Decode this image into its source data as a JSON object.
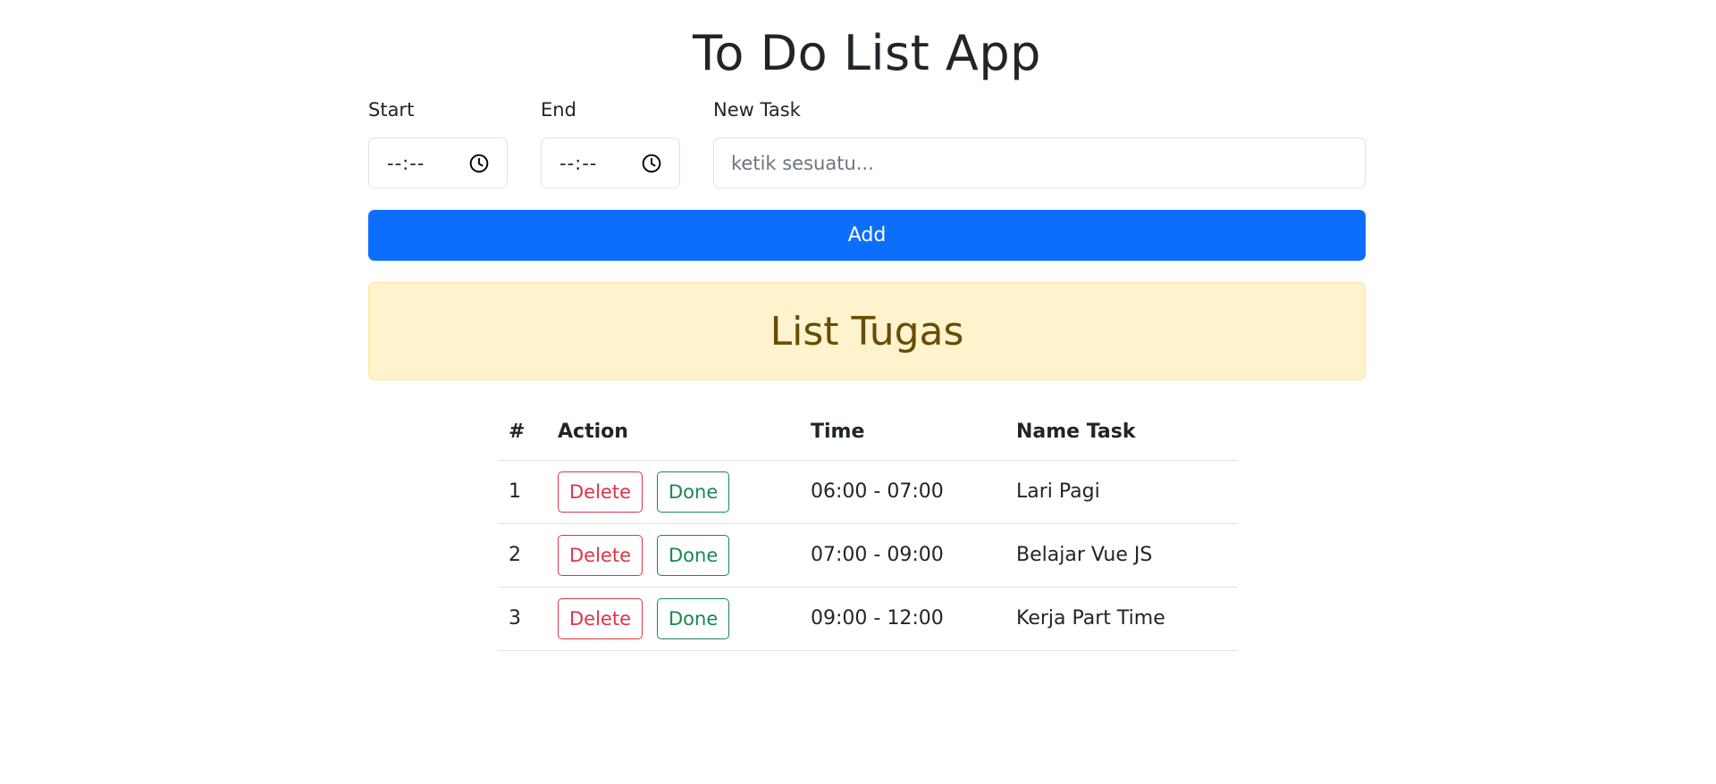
{
  "app": {
    "title": "To Do List App"
  },
  "form": {
    "start_label": "Start",
    "start_value": "--:--",
    "end_label": "End",
    "end_value": "--:--",
    "task_label": "New Task",
    "task_placeholder": "ketik sesuatu...",
    "task_value": "",
    "add_label": "Add"
  },
  "list": {
    "heading": "List Tugas",
    "columns": [
      "#",
      "Action",
      "Time",
      "Name Task"
    ],
    "delete_label": "Delete",
    "done_label": "Done",
    "rows": [
      {
        "num": "1",
        "time": "06:00 - 07:00",
        "name": "Lari Pagi"
      },
      {
        "num": "2",
        "time": "07:00 - 09:00",
        "name": "Belajar Vue JS"
      },
      {
        "num": "3",
        "time": "09:00 - 12:00",
        "name": "Kerja Part Time"
      }
    ]
  },
  "colors": {
    "primary": "#0d6efd",
    "danger": "#dc3545",
    "success": "#198754",
    "warning_bg": "#fff3cd",
    "warning_text": "#664d03"
  },
  "icons": {
    "time_input": "clock-icon"
  }
}
